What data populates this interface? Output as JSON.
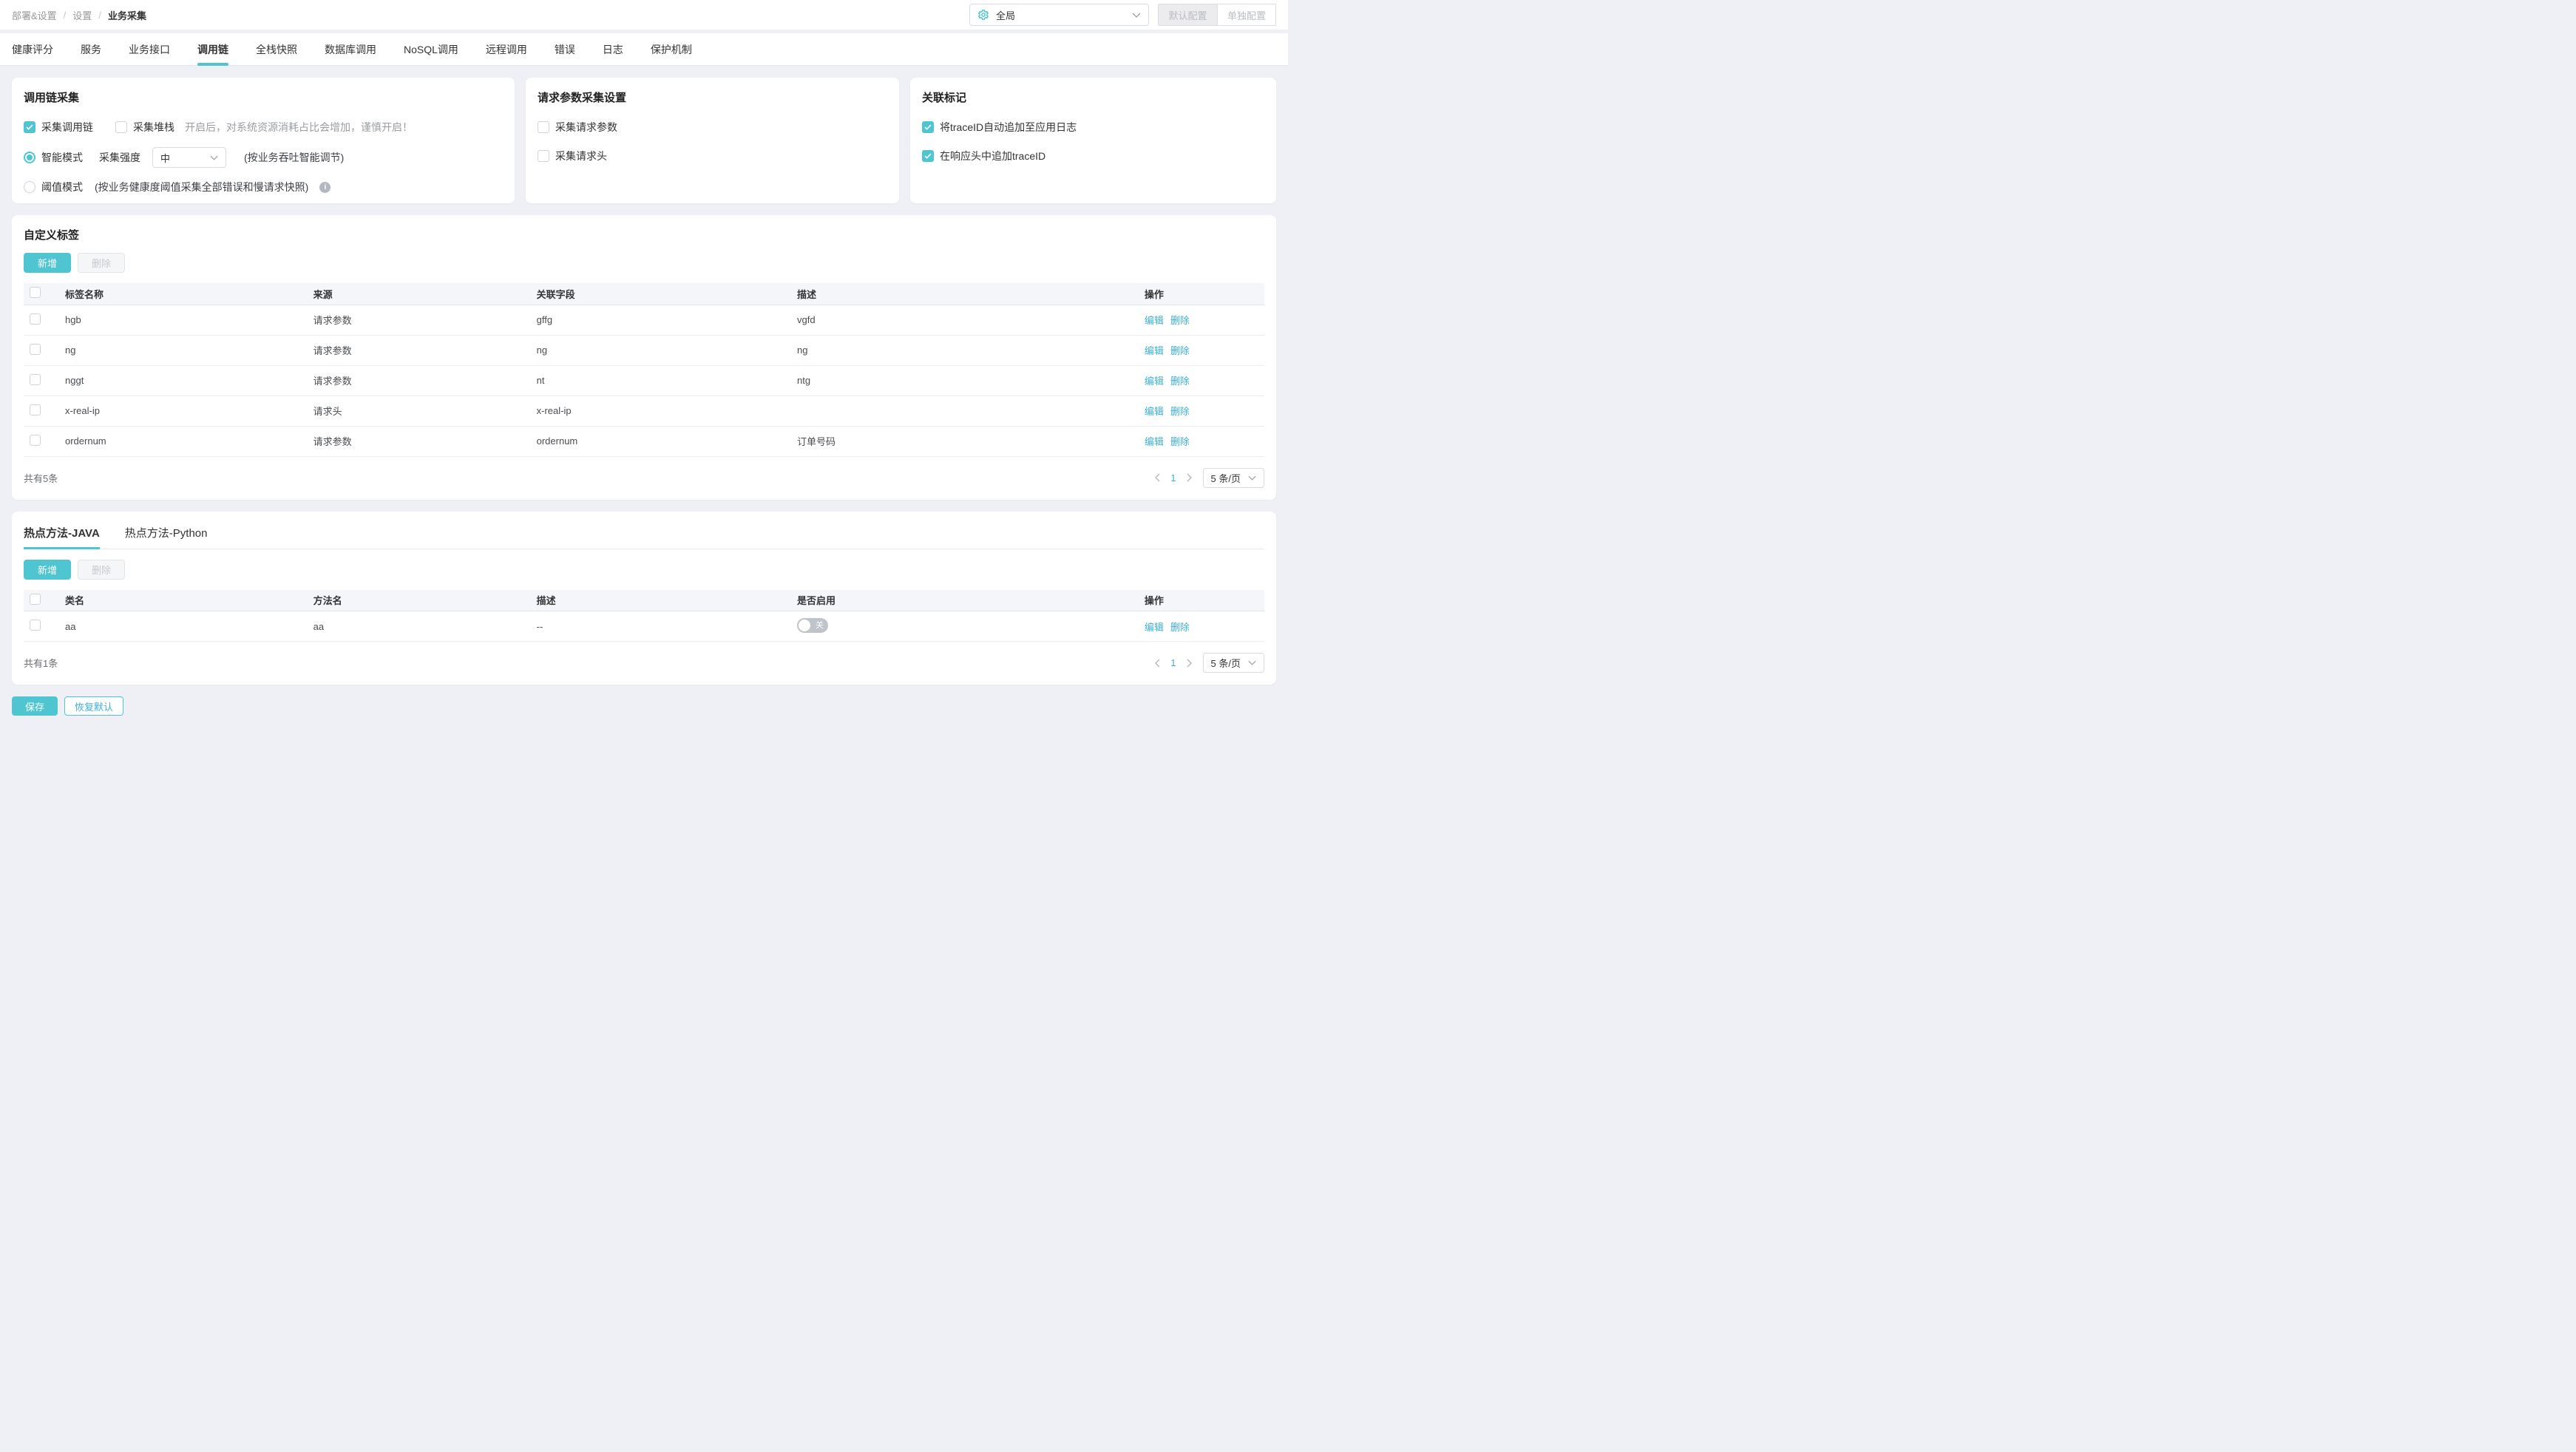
{
  "breadcrumb": {
    "separator": "/",
    "items": [
      "部署&设置",
      "设置",
      "业务采集"
    ]
  },
  "header": {
    "scope_select": {
      "value": "全局",
      "icon": "gear-icon"
    },
    "default_config_label": "默认配置",
    "separate_config_label": "单独配置"
  },
  "tabs": {
    "active": "调用链",
    "items": [
      "健康评分",
      "服务",
      "业务接口",
      "调用链",
      "全栈快照",
      "数据库调用",
      "NoSQL调用",
      "远程调用",
      "错误",
      "日志",
      "保护机制"
    ]
  },
  "trace_card": {
    "title": "调用链采集",
    "collect_trace": {
      "label": "采集调用链",
      "checked": true
    },
    "collect_stack": {
      "label": "采集堆栈",
      "checked": false,
      "hint": "开启后，对系统资源消耗占比会增加，谨慎开启！"
    },
    "smart_mode": {
      "label": "智能模式",
      "selected": true,
      "strength_label": "采集强度",
      "strength_value": "中",
      "hint": "(按业务吞吐智能调节)"
    },
    "threshold_mode": {
      "label": "阈值模式",
      "selected": false,
      "hint": "(按业务健康度阈值采集全部错误和慢请求快照)"
    }
  },
  "request_params_card": {
    "title": "请求参数采集设置",
    "collect_params": {
      "label": "采集请求参数",
      "checked": false
    },
    "collect_headers": {
      "label": "采集请求头",
      "checked": false
    }
  },
  "correlation_card": {
    "title": "关联标记",
    "append_log": {
      "label": "将traceID自动追加至应用日志",
      "checked": true
    },
    "append_header": {
      "label": "在响应头中追加traceID",
      "checked": true
    }
  },
  "custom_tags": {
    "title": "自定义标签",
    "add_label": "新增",
    "delete_label": "删除",
    "columns": [
      "标签名称",
      "来源",
      "关联字段",
      "描述",
      "操作"
    ],
    "actions": {
      "edit": "编辑",
      "delete": "删除"
    },
    "rows": [
      {
        "name": "hgb",
        "source": "请求参数",
        "field": "gffg",
        "desc": "vgfd"
      },
      {
        "name": "ng",
        "source": "请求参数",
        "field": "ng",
        "desc": "ng"
      },
      {
        "name": "nggt",
        "source": "请求参数",
        "field": "nt",
        "desc": "ntg"
      },
      {
        "name": "x-real-ip",
        "source": "请求头",
        "field": "x-real-ip",
        "desc": ""
      },
      {
        "name": "ordernum",
        "source": "请求参数",
        "field": "ordernum",
        "desc": "订单号码"
      }
    ],
    "pagination": {
      "total": "共有5条",
      "current_page": "1",
      "page_size": "5 条/页"
    }
  },
  "hot_methods": {
    "tab_java": "热点方法-JAVA",
    "tab_python": "热点方法-Python",
    "add_label": "新增",
    "delete_label": "删除",
    "columns": [
      "类名",
      "方法名",
      "描述",
      "是否启用",
      "操作"
    ],
    "actions": {
      "edit": "编辑",
      "delete": "删除"
    },
    "rows": [
      {
        "class_name": "aa",
        "method_name": "aa",
        "desc": "--",
        "enabled": false,
        "toggle_label": "关"
      }
    ],
    "pagination": {
      "total": "共有1条",
      "current_page": "1",
      "page_size": "5 条/页"
    }
  },
  "footer": {
    "save_label": "保存",
    "restore_label": "恢复默认"
  },
  "colors": {
    "accent": "#4ec5d0",
    "link": "#3db1d6",
    "toggle_off": "#bfc3ca"
  }
}
